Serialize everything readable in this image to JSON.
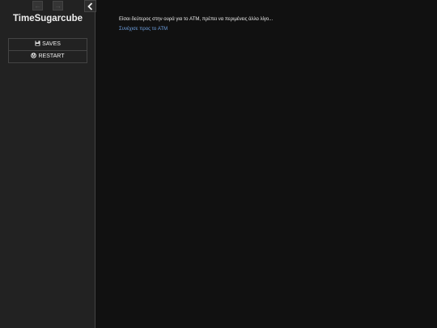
{
  "sidebar": {
    "story_title": "TimeSugarcube",
    "history": {
      "back_icon": "arrow-left-icon",
      "forward_icon": "arrow-right-icon"
    },
    "toggle_icon": "chevron-left-icon",
    "menu": [
      {
        "label": "SAVES",
        "icon": "save-icon"
      },
      {
        "label": "RESTART",
        "icon": "power-icon"
      }
    ]
  },
  "passage": {
    "text": "Είσαι δεύτερος στην ουρά για το ATM, πρέπει να περιμένεις άλλο λίγο...",
    "link": "Συνέχισε προς το ATM"
  },
  "colors": {
    "background": "#111111",
    "sidebar": "#222222",
    "link": "#6ea0e0",
    "text": "#eeeeee"
  }
}
